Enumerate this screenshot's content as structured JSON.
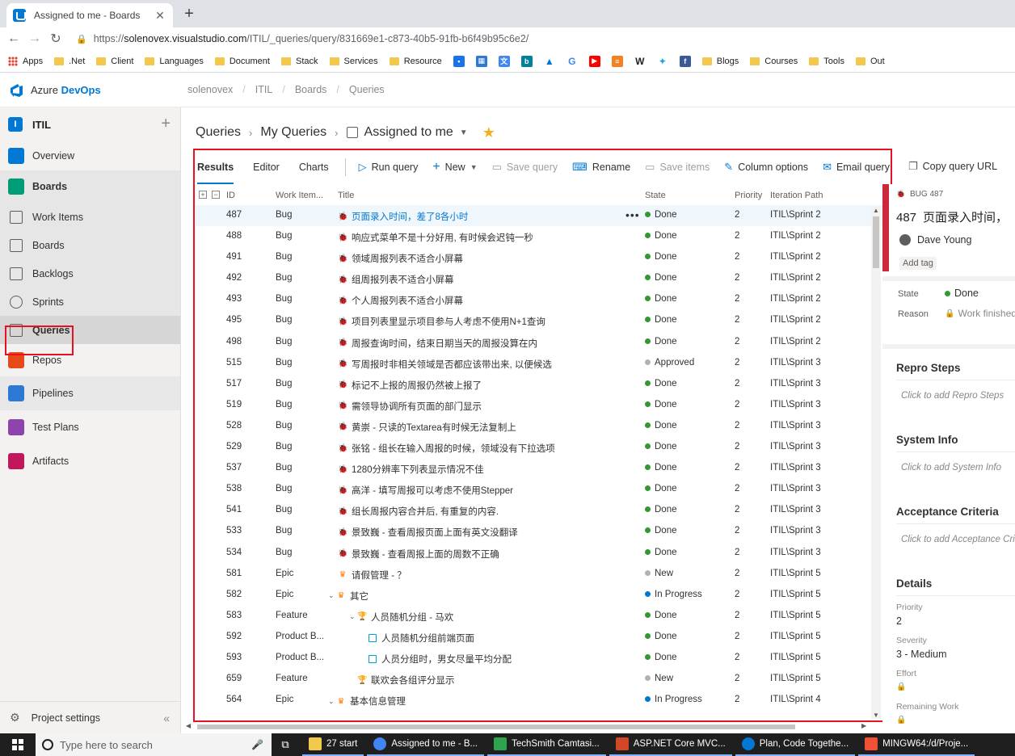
{
  "browser": {
    "tab_title": "Assigned to me - Boards",
    "url_prefix": "https://",
    "url_host": "solenovex.visualstudio.com",
    "url_path": "/ITIL/_queries/query/831669e1-c873-40b5-91fb-b6f49b95c6e2/"
  },
  "bookmarks": {
    "items": [
      "Apps",
      ".Net",
      "Client",
      "Languages",
      "Document",
      "Stack",
      "Services",
      "Resource"
    ],
    "items2": [
      "Blogs",
      "Courses",
      "Tools",
      "Out"
    ]
  },
  "ado": {
    "brand_prefix": "Azure ",
    "brand_accent": "DevOps",
    "crumbs": [
      "solenovex",
      "ITIL",
      "Boards",
      "Queries"
    ]
  },
  "sidebar": {
    "project_badge": "I",
    "project_name": "ITIL",
    "items": [
      {
        "label": "Overview",
        "color": "#0078d4"
      },
      {
        "label": "Boards",
        "color": "#009b77"
      },
      {
        "label": "Work Items"
      },
      {
        "label": "Boards"
      },
      {
        "label": "Backlogs"
      },
      {
        "label": "Sprints"
      },
      {
        "label": "Queries"
      },
      {
        "label": "Repos",
        "color": "#e64a19"
      },
      {
        "label": "Pipelines",
        "color": "#2d7ad6"
      },
      {
        "label": "Test Plans",
        "color": "#8e44ad"
      },
      {
        "label": "Artifacts",
        "color": "#c2185b"
      }
    ],
    "settings_label": "Project settings"
  },
  "query": {
    "crumb_root": "Queries",
    "crumb_folder": "My Queries",
    "crumb_current": "Assigned to me"
  },
  "toolbar": {
    "tabs": [
      "Results",
      "Editor",
      "Charts"
    ],
    "run": "Run query",
    "new": "New",
    "save_query": "Save query",
    "rename": "Rename",
    "save_items": "Save items",
    "column_options": "Column options",
    "email_query": "Email query",
    "copy_url": "Copy query URL"
  },
  "grid": {
    "headers": [
      "ID",
      "Work Item...",
      "Title",
      "State",
      "Priority",
      "Iteration Path"
    ],
    "rows": [
      {
        "id": "487",
        "type": "Bug",
        "title": "页面录入时间，差了8各小时",
        "state": "Done",
        "priority": "2",
        "iteration": "ITIL\\Sprint 2"
      },
      {
        "id": "488",
        "type": "Bug",
        "title": "响应式菜单不是十分好用, 有时候会迟钝一秒",
        "state": "Done",
        "priority": "2",
        "iteration": "ITIL\\Sprint 2"
      },
      {
        "id": "491",
        "type": "Bug",
        "title": "领域周报列表不适合小屏幕",
        "state": "Done",
        "priority": "2",
        "iteration": "ITIL\\Sprint 2"
      },
      {
        "id": "492",
        "type": "Bug",
        "title": "组周报列表不适合小屏幕",
        "state": "Done",
        "priority": "2",
        "iteration": "ITIL\\Sprint 2"
      },
      {
        "id": "493",
        "type": "Bug",
        "title": "个人周报列表不适合小屏幕",
        "state": "Done",
        "priority": "2",
        "iteration": "ITIL\\Sprint 2"
      },
      {
        "id": "495",
        "type": "Bug",
        "title": "项目列表里显示项目参与人考虑不使用N+1查询",
        "state": "Done",
        "priority": "2",
        "iteration": "ITIL\\Sprint 2"
      },
      {
        "id": "498",
        "type": "Bug",
        "title": "周报查询时间，结束日期当天的周报没算在内",
        "state": "Done",
        "priority": "2",
        "iteration": "ITIL\\Sprint 2"
      },
      {
        "id": "515",
        "type": "Bug",
        "title": "写周报时非相关领域是否都应该带出来, 以便候选",
        "state": "Approved",
        "priority": "2",
        "iteration": "ITIL\\Sprint 3"
      },
      {
        "id": "517",
        "type": "Bug",
        "title": "标记不上报的周报仍然被上报了",
        "state": "Done",
        "priority": "2",
        "iteration": "ITIL\\Sprint 3"
      },
      {
        "id": "519",
        "type": "Bug",
        "title": "需领导协调所有页面的部门显示",
        "state": "Done",
        "priority": "2",
        "iteration": "ITIL\\Sprint 3"
      },
      {
        "id": "528",
        "type": "Bug",
        "title": "黄崇 - 只读的Textarea有时候无法复制上",
        "state": "Done",
        "priority": "2",
        "iteration": "ITIL\\Sprint 3"
      },
      {
        "id": "529",
        "type": "Bug",
        "title": "张铭 - 组长在输入周报的时候，领域没有下拉选项",
        "state": "Done",
        "priority": "2",
        "iteration": "ITIL\\Sprint 3"
      },
      {
        "id": "537",
        "type": "Bug",
        "title": "1280分辨率下列表显示情况不佳",
        "state": "Done",
        "priority": "2",
        "iteration": "ITIL\\Sprint 3"
      },
      {
        "id": "538",
        "type": "Bug",
        "title": "高洋 - 填写周报可以考虑不使用Stepper",
        "state": "Done",
        "priority": "2",
        "iteration": "ITIL\\Sprint 3"
      },
      {
        "id": "541",
        "type": "Bug",
        "title": "组长周报内容合并后, 有重复的内容.",
        "state": "Done",
        "priority": "2",
        "iteration": "ITIL\\Sprint 3"
      },
      {
        "id": "533",
        "type": "Bug",
        "title": "景致巍 - 查看周报页面上面有英文没翻译",
        "state": "Done",
        "priority": "2",
        "iteration": "ITIL\\Sprint 3"
      },
      {
        "id": "534",
        "type": "Bug",
        "title": "景致巍 - 查看周报上面的周数不正确",
        "state": "Done",
        "priority": "2",
        "iteration": "ITIL\\Sprint 3"
      },
      {
        "id": "581",
        "type": "Epic",
        "title": "请假管理 - ？",
        "state": "New",
        "priority": "2",
        "iteration": "ITIL\\Sprint 5"
      },
      {
        "id": "582",
        "type": "Epic",
        "title": "其它",
        "state": "In Progress",
        "priority": "2",
        "iteration": "ITIL\\Sprint 5"
      },
      {
        "id": "583",
        "type": "Feature",
        "title": "人员随机分组 - 马欢",
        "state": "Done",
        "priority": "2",
        "iteration": "ITIL\\Sprint 5"
      },
      {
        "id": "592",
        "type": "Product B...",
        "title": "人员随机分组前端页面",
        "state": "Done",
        "priority": "2",
        "iteration": "ITIL\\Sprint 5"
      },
      {
        "id": "593",
        "type": "Product B...",
        "title": "人员分组时，男女尽量平均分配",
        "state": "Done",
        "priority": "2",
        "iteration": "ITIL\\Sprint 5"
      },
      {
        "id": "659",
        "type": "Feature",
        "title": "联欢会各组评分显示",
        "state": "New",
        "priority": "2",
        "iteration": "ITIL\\Sprint 5"
      },
      {
        "id": "564",
        "type": "Epic",
        "title": "基本信息管理",
        "state": "In Progress",
        "priority": "2",
        "iteration": "ITIL\\Sprint 4"
      }
    ]
  },
  "state_colors": {
    "Done": "#339933",
    "Approved": "#b2b2b2",
    "New": "#b2b2b2",
    "In Progress": "#007acc"
  },
  "detail": {
    "type_label": "BUG 487",
    "id": "487",
    "title": "页面录入时间，",
    "assignee": "Dave Young",
    "add_tag": "Add tag",
    "state_label": "State",
    "state_value": "Done",
    "reason_label": "Reason",
    "reason_value": "Work finished",
    "repro_title": "Repro Steps",
    "repro_placeholder": "Click to add Repro Steps",
    "sysinfo_title": "System Info",
    "sysinfo_placeholder": "Click to add System Info",
    "accept_title": "Acceptance Criteria",
    "accept_placeholder": "Click to add Acceptance Criteria",
    "details_title": "Details",
    "priority_label": "Priority",
    "priority_value": "2",
    "severity_label": "Severity",
    "severity_value": "3 - Medium",
    "effort_label": "Effort",
    "remaining_label": "Remaining Work"
  },
  "taskbar": {
    "search_placeholder": "Type here to search",
    "items": [
      "27 start",
      "Assigned to me - B...",
      "TechSmith Camtasi...",
      "ASP.NET Core MVC...",
      "Plan, Code Togethe...",
      "MINGW64:/d/Proje..."
    ]
  }
}
